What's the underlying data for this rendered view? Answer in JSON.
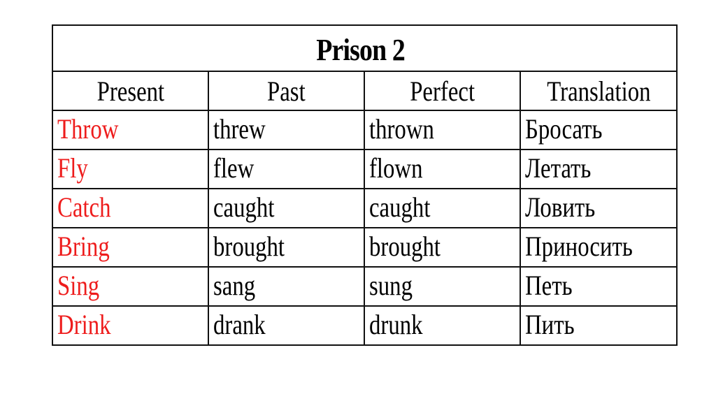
{
  "table": {
    "title": "Prison 2",
    "headers": [
      "Present",
      "Past",
      "Perfect",
      "Translation"
    ],
    "rows": [
      [
        "Throw",
        "threw",
        "thrown",
        "Бросать"
      ],
      [
        "Fly",
        "flew",
        "flown",
        "Летать"
      ],
      [
        "Catch",
        "caught",
        "caught",
        "Ловить"
      ],
      [
        "Bring",
        "brought",
        "brought",
        "Приносить"
      ],
      [
        "Sing",
        "sang",
        "sung",
        "Петь"
      ],
      [
        "Drink",
        "drank",
        "drunk",
        "Пить"
      ]
    ]
  },
  "colors": {
    "present_text": "#ee1c1c",
    "text": "#000000",
    "border": "#111111",
    "background": "#ffffff"
  }
}
